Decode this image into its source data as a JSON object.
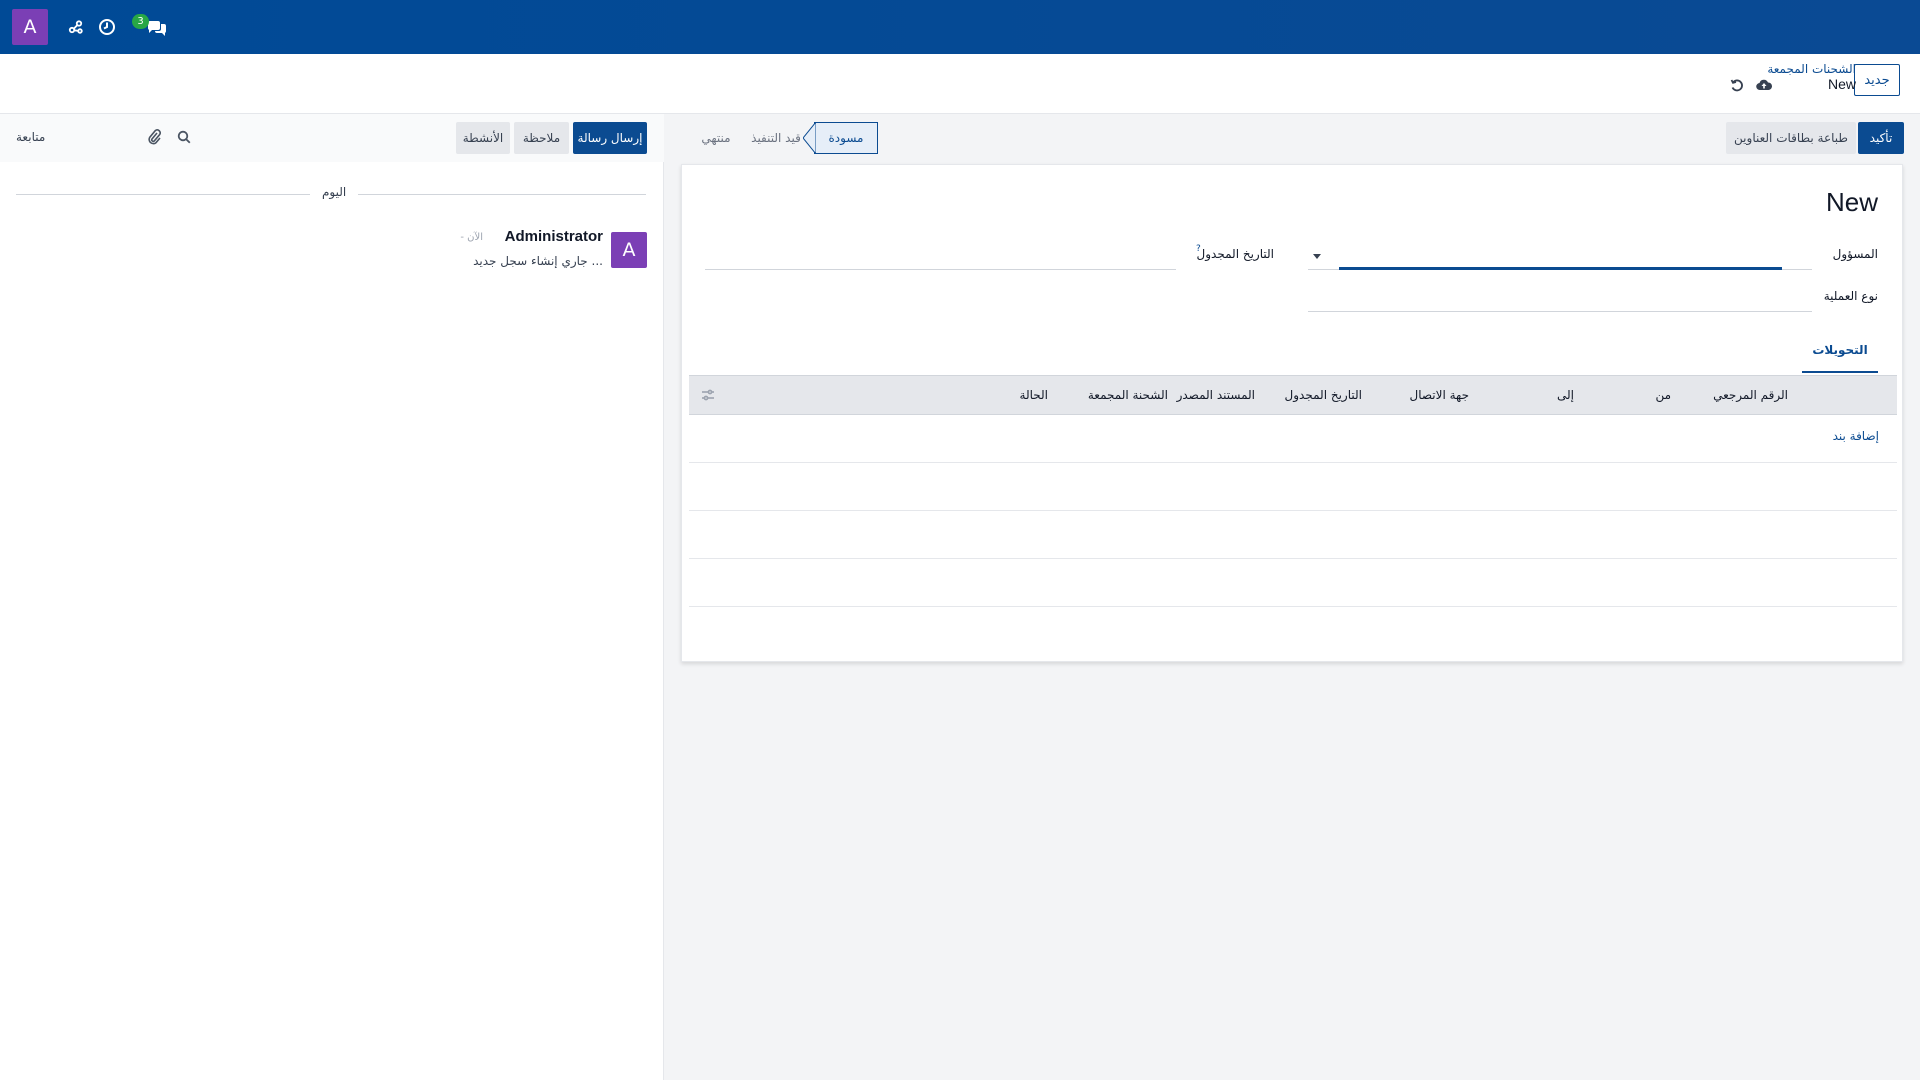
{
  "navbar": {
    "avatar_letter": "A",
    "chat_badge": "3",
    "icons": [
      "activity-graph-icon",
      "clock-icon",
      "chat-icon"
    ]
  },
  "control_panel": {
    "new_button": "جديد",
    "breadcrumb_parent": "الشحنات المجمعة",
    "breadcrumb_current": "New",
    "icons": [
      "cloud-save-icon",
      "discard-icon"
    ]
  },
  "chatter": {
    "send_message": "إرسال رسالة",
    "log_note": "ملاحظة",
    "activities": "الأنشطة",
    "follow": "متابعة",
    "day_label": "اليوم",
    "message": {
      "avatar_letter": "A",
      "author": "Administrator",
      "time": "- الآن",
      "body": "جاري إنشاء سجل جديد ..."
    }
  },
  "form": {
    "buttons": {
      "confirm": "تأكيد",
      "print_labels": "طباعة بطاقات العناوين"
    },
    "stages": {
      "draft": "مسودة",
      "in_progress": "قيد التنفيذ",
      "done": "منتهي"
    },
    "title": "New",
    "fields": {
      "responsible": "المسؤول",
      "operation_type": "نوع العملية",
      "scheduled_date": "التاريخ المجدول",
      "tooltip": "?"
    },
    "tab_transfers": "التحويلات",
    "columns": [
      "الرقم المرجعي",
      "من",
      "إلى",
      "جهة الاتصال",
      "التاريخ المجدول",
      "المستند المصدر",
      "الشحنة المجمعة",
      "الحالة"
    ],
    "add_line": "إضافة بند"
  },
  "colors": {
    "navbar": "#004a96",
    "primary": "#0b4b91",
    "avatar": "#7b3fb5",
    "badge": "#28a745"
  }
}
